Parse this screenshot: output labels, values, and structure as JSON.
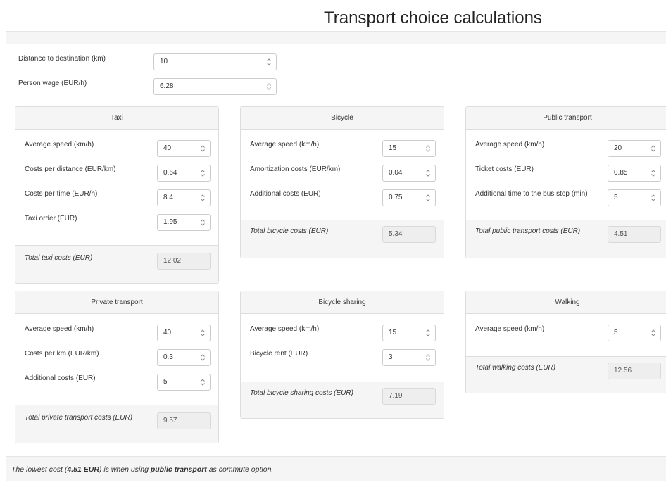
{
  "title": "Transport choice calculations",
  "top_fields": {
    "distance": {
      "label": "Distance to destination (km)",
      "value": "10"
    },
    "wage": {
      "label": "Person wage (EUR/h)",
      "value": "6.28"
    }
  },
  "panels": {
    "taxi": {
      "title": "Taxi",
      "rows": [
        {
          "label": "Average speed (km/h)",
          "value": "40"
        },
        {
          "label": "Costs per distance (EUR/km)",
          "value": "0.64"
        },
        {
          "label": "Costs per time (EUR/h)",
          "value": "8.4"
        },
        {
          "label": "Taxi order (EUR)",
          "value": "1.95"
        }
      ],
      "total_label": "Total taxi costs (EUR)",
      "total_value": "12.02"
    },
    "bicycle": {
      "title": "Bicycle",
      "rows": [
        {
          "label": "Average speed (km/h)",
          "value": "15"
        },
        {
          "label": "Amortization costs (EUR/km)",
          "value": "0.04"
        },
        {
          "label": "Additional costs (EUR)",
          "value": "0.75"
        }
      ],
      "total_label": "Total bicycle costs (EUR)",
      "total_value": "5.34"
    },
    "public": {
      "title": "Public transport",
      "rows": [
        {
          "label": "Average speed (km/h)",
          "value": "20"
        },
        {
          "label": "Ticket costs (EUR)",
          "value": "0.85"
        },
        {
          "label": "Additional time to the bus stop (min)",
          "value": "5"
        }
      ],
      "total_label": "Total public transport costs (EUR)",
      "total_value": "4.51"
    },
    "private": {
      "title": "Private transport",
      "rows": [
        {
          "label": "Average speed (km/h)",
          "value": "40"
        },
        {
          "label": "Costs per km (EUR/km)",
          "value": "0.3"
        },
        {
          "label": "Additional costs (EUR)",
          "value": "5"
        }
      ],
      "total_label": "Total private transport costs (EUR)",
      "total_value": "9.57"
    },
    "sharing": {
      "title": "Bicycle sharing",
      "rows": [
        {
          "label": "Average speed (km/h)",
          "value": "15"
        },
        {
          "label": "Bicycle rent (EUR)",
          "value": "3"
        }
      ],
      "total_label": "Total bicycle sharing costs (EUR)",
      "total_value": "7.19"
    },
    "walking": {
      "title": "Walking",
      "rows": [
        {
          "label": "Average speed (km/h)",
          "value": "5"
        }
      ],
      "total_label": "Total walking costs (EUR)",
      "total_value": "12.56"
    }
  },
  "result": {
    "prefix": "The lowest cost (",
    "amount": "4.51 EUR",
    "middle": ") is when using ",
    "mode": "public transport",
    "suffix": " as commute option."
  }
}
